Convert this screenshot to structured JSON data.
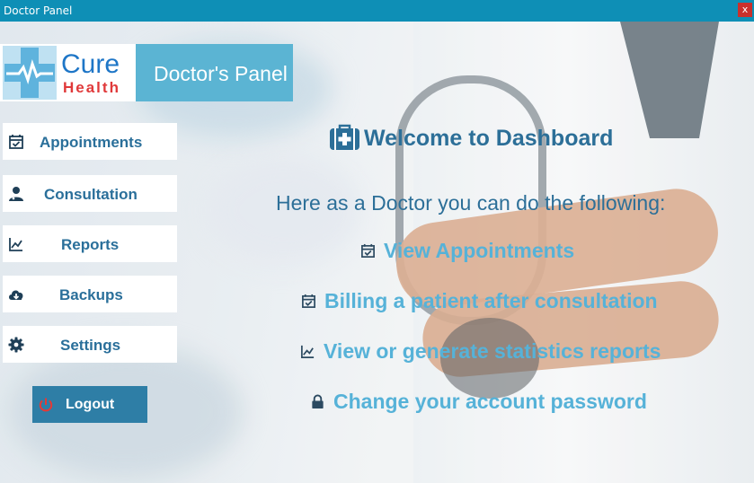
{
  "window": {
    "title": "Doctor Panel",
    "close_label": "x"
  },
  "brand": {
    "logo_line1": "Cure",
    "logo_line2": "Health",
    "panel_title": "Doctor's Panel"
  },
  "sidebar": {
    "items": [
      {
        "label": "Appointments",
        "icon": "calendar-check-icon"
      },
      {
        "label": "Consultation",
        "icon": "user-doctor-icon"
      },
      {
        "label": "Reports",
        "icon": "line-chart-icon"
      },
      {
        "label": "Backups",
        "icon": "cloud-download-icon"
      },
      {
        "label": "Settings",
        "icon": "gear-icon"
      }
    ],
    "logout_label": "Logout"
  },
  "main": {
    "welcome": "Welcome to Dashboard",
    "subtitle": "Here as a Doctor you can do the following:",
    "features": [
      {
        "label": "View Appointments",
        "icon": "calendar-check-icon"
      },
      {
        "label": "Billing a patient after consultation",
        "icon": "calendar-check-icon"
      },
      {
        "label": "View or generate statistics reports",
        "icon": "line-chart-icon"
      },
      {
        "label": "Change your account password",
        "icon": "lock-icon"
      }
    ]
  },
  "colors": {
    "titlebar": "#0e8fb6",
    "panel_header": "#5bb4d3",
    "nav_text": "#2a6f9a",
    "logout_bg": "#2e7ea6",
    "feature_text": "#56b2d8",
    "logo_blue": "#1e76c7",
    "logo_red": "#e0393a"
  }
}
